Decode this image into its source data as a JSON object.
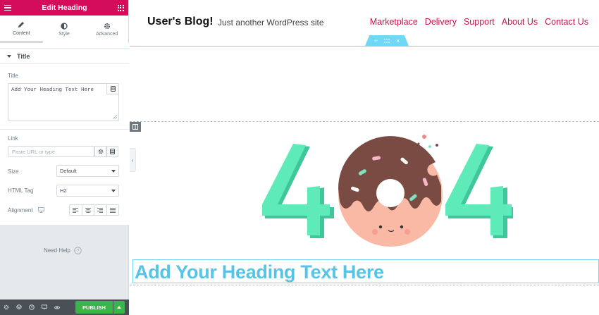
{
  "panel": {
    "header_title": "Edit Heading",
    "tabs": [
      {
        "label": "Content",
        "icon": "pencil-icon"
      },
      {
        "label": "Style",
        "icon": "half-circle-icon"
      },
      {
        "label": "Advanced",
        "icon": "gear-icon"
      }
    ],
    "section_title": "Title",
    "title_label": "Title",
    "title_value": "Add Your Heading Text Here",
    "link_label": "Link",
    "link_placeholder": "Paste URL or type",
    "size_label": "Size",
    "size_value": "Default",
    "html_tag_label": "HTML Tag",
    "html_tag_value": "H2",
    "alignment_label": "Alignment",
    "need_help": "Need Help",
    "publish_label": "PUBLISH"
  },
  "site": {
    "title": "User's Blog!",
    "tagline": "Just another WordPress site",
    "nav": [
      "Marketplace",
      "Delivery",
      "Support",
      "About Us",
      "Contact Us"
    ]
  },
  "heading_text": "Add Your Heading Text Here",
  "colors": {
    "brand": "#d30c5c",
    "nav_link": "#c4144e",
    "publish": "#39b54a",
    "heading": "#55c4e6",
    "four": "#5eeab9",
    "donut": "#f9b9a4",
    "frosting": "#7a4b43"
  }
}
